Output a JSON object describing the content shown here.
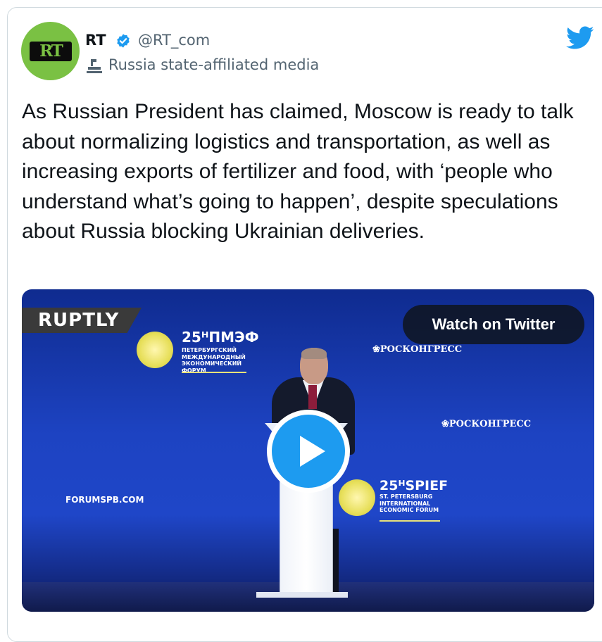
{
  "tweet": {
    "author_name": "RT",
    "handle": "@RT_com",
    "affiliation_label": "Russia state-affiliated media",
    "avatar_logo_text": "RT",
    "text": "As Russian President has claimed, Moscow is ready to talk about normalizing logistics and transportation, as well as increasing exports of fertilizer and food, with ‘people who understand what’s going to happen’, despite speculations about Russia blocking Ukrainian deliveries."
  },
  "media": {
    "watch_button_label": "Watch on Twitter",
    "overlay_brand": "RUPTLY",
    "backdrop": {
      "pmef_title": "25ᴴПМЭФ",
      "pmef_subtitle": "ПЕТЕРБУРГСКИЙ МЕЖДУНАРОДНЫЙ ЭКОНОМИЧЕСКИЙ ФОРУМ",
      "roscongress_1": "❀РОСКОНГРЕСС",
      "roscongress_2": "❀РОСКОНГРЕСС",
      "spief_title": "25ᴴSPIEF",
      "spief_subtitle": "ST. PETERSBURG INTERNATIONAL ECONOMIC FORUM",
      "website": "FORUMSPB.COM"
    }
  },
  "icons": {
    "verified": "verified-badge-icon",
    "affiliation": "podium-icon",
    "platform": "twitter-bird-icon",
    "play": "play-icon"
  },
  "colors": {
    "accent": "#1d9bf0",
    "avatar_bg": "#7ac143",
    "secondary_text": "#536471"
  }
}
